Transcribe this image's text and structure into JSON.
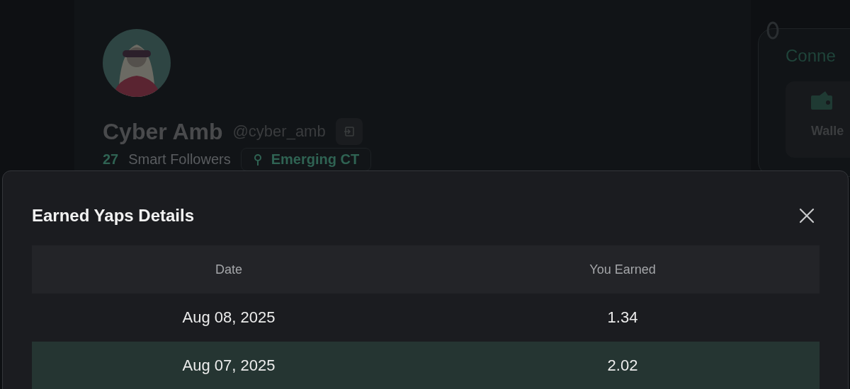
{
  "profile": {
    "name": "Cyber Amb",
    "handle": "@cyber_amb",
    "smart_followers_count": "27",
    "smart_followers_label": "Smart Followers",
    "tag": "Emerging CT"
  },
  "connect_card": {
    "title": "Conne",
    "option": "Walle"
  },
  "modal": {
    "title": "Earned Yaps Details",
    "table": {
      "columns": [
        "Date",
        "You Earned"
      ],
      "rows": [
        {
          "cells": [
            "Aug 08, 2025",
            "1.34"
          ],
          "highlighted": false
        },
        {
          "cells": [
            "Aug 07, 2025",
            "2.02"
          ],
          "highlighted": true
        }
      ]
    }
  }
}
